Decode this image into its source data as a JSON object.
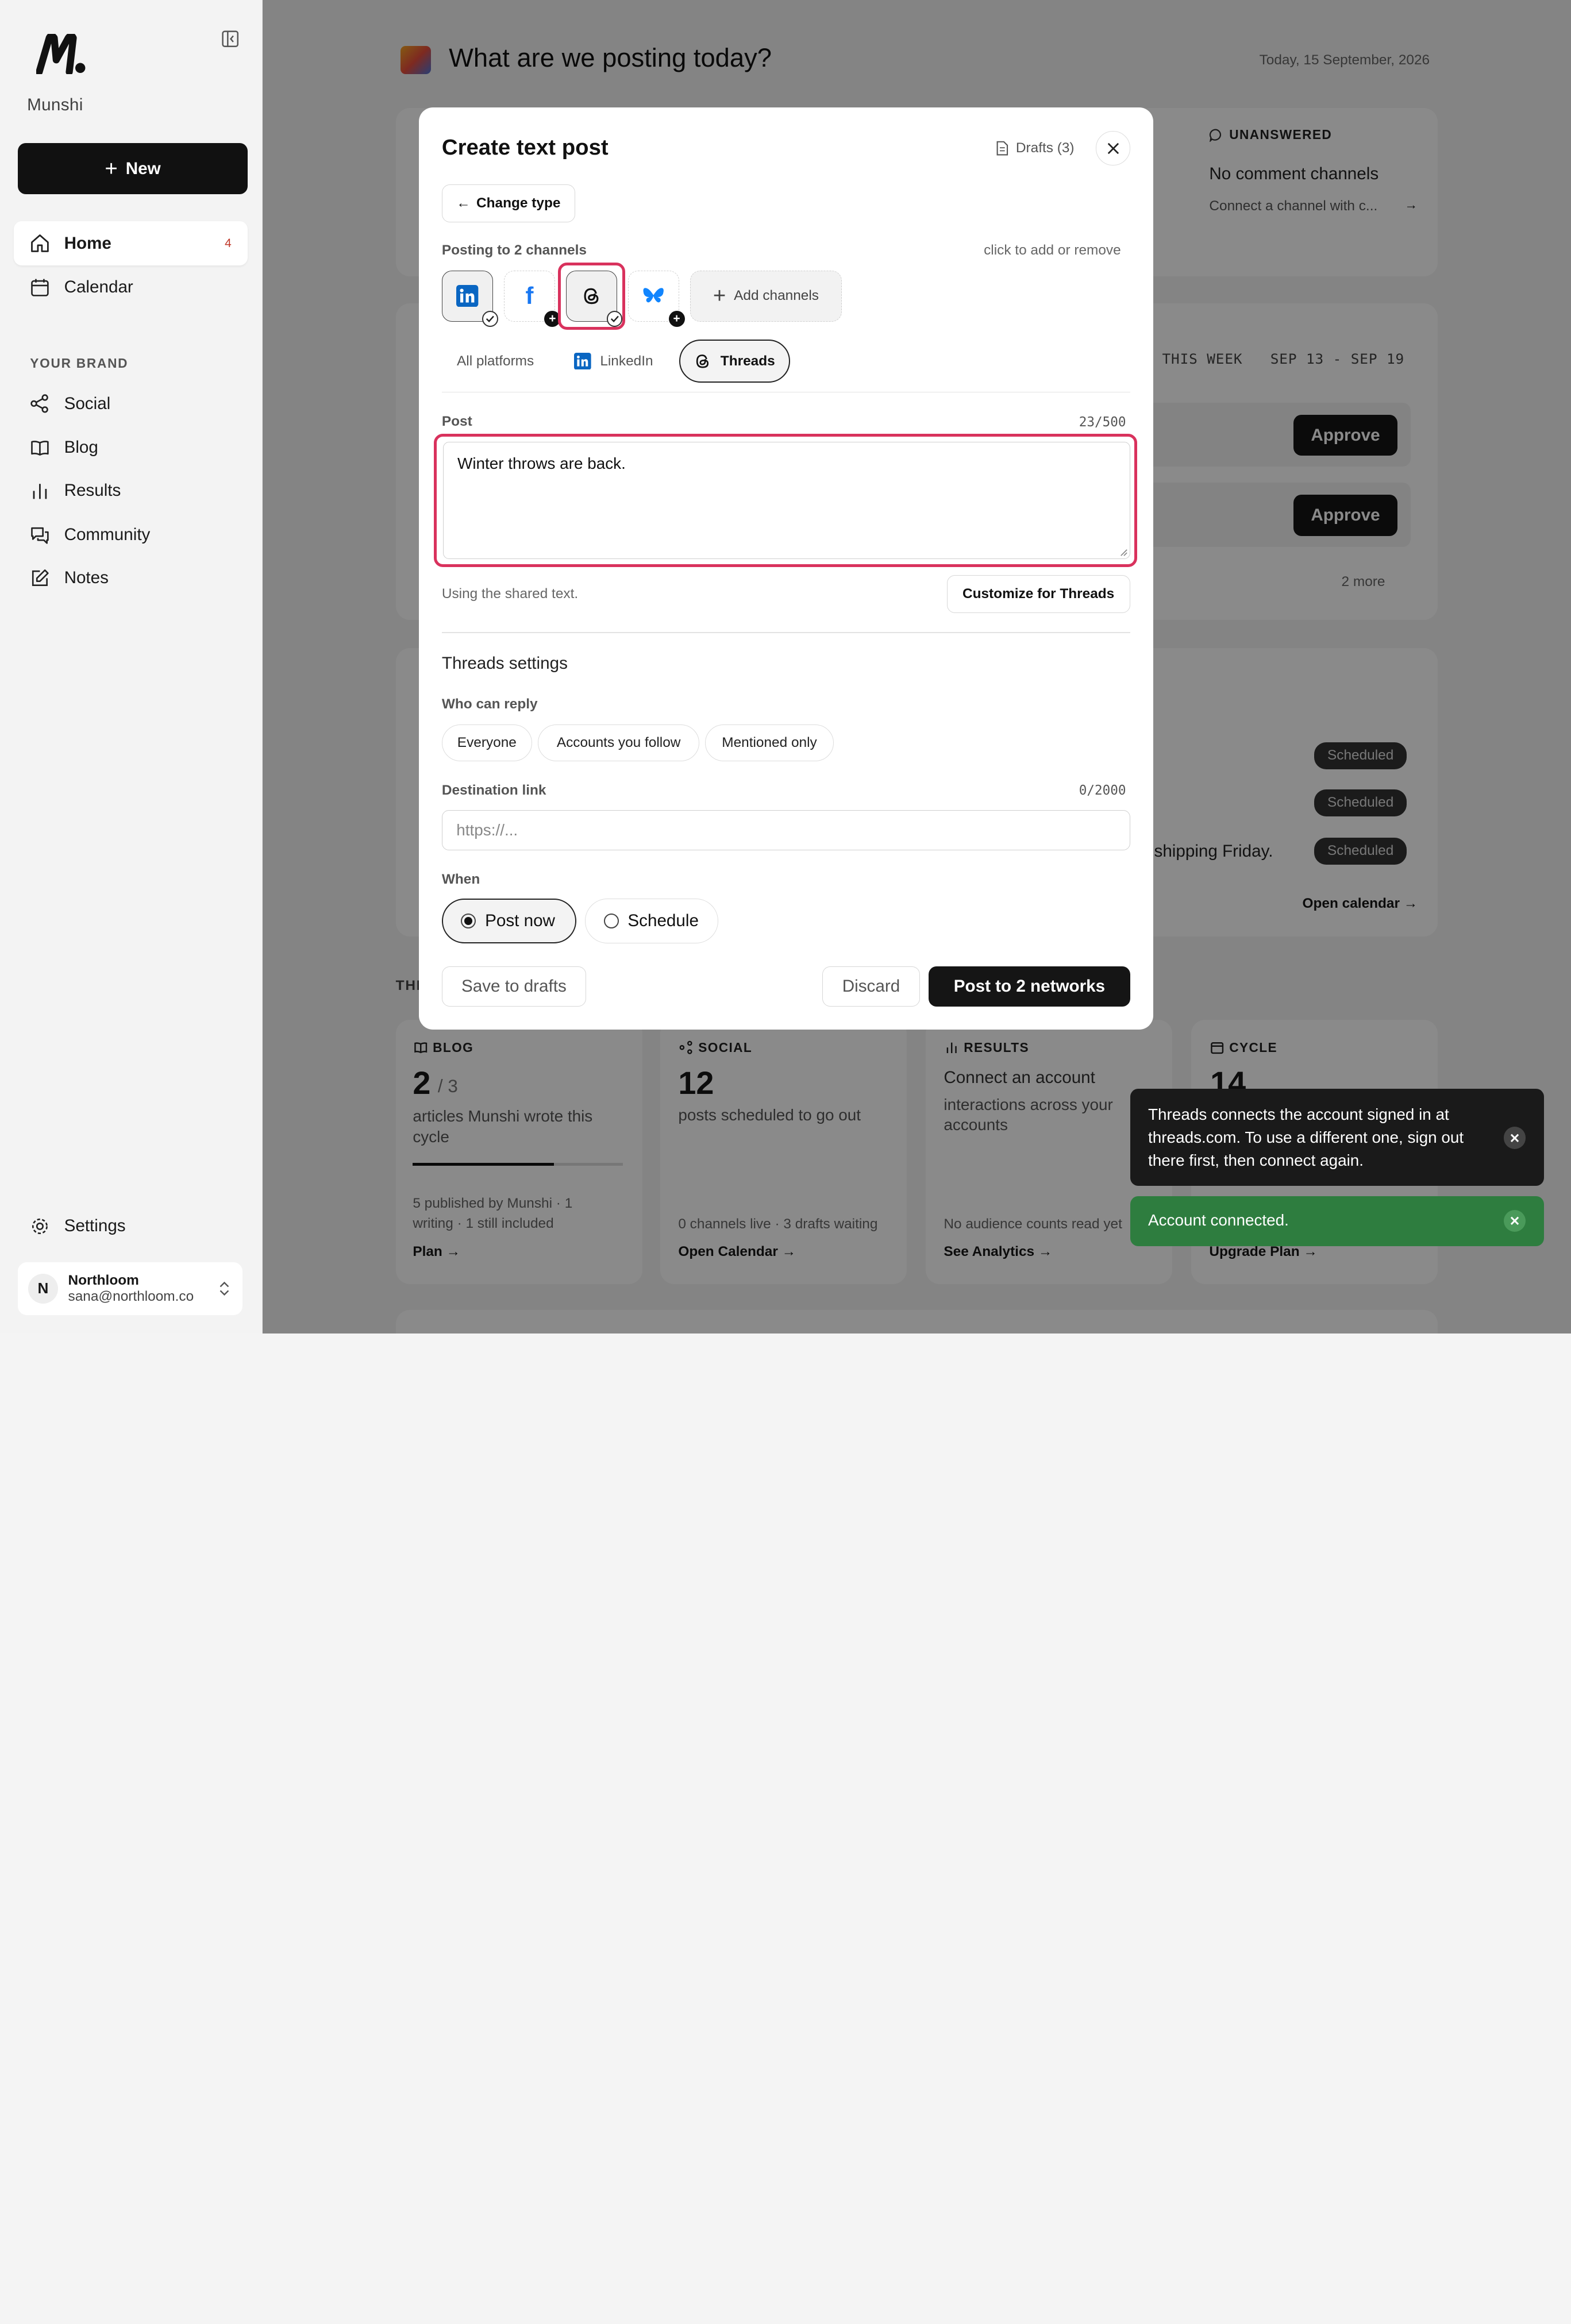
{
  "app": {
    "name": "Munshi",
    "new_label": "New"
  },
  "sidebar": {
    "items": [
      {
        "label": "Home",
        "badge": "4"
      },
      {
        "label": "Calendar"
      }
    ],
    "section_title": "YOUR BRAND",
    "brand_items": [
      {
        "label": "Social"
      },
      {
        "label": "Blog"
      },
      {
        "label": "Results"
      },
      {
        "label": "Community"
      },
      {
        "label": "Notes"
      }
    ],
    "settings_label": "Settings",
    "account": {
      "initial": "N",
      "name": "Northloom",
      "email": "sana@northloom.co"
    }
  },
  "header": {
    "greeting": "What are we posting today?",
    "date": "Today, 15 September, 2026"
  },
  "background": {
    "unanswered": {
      "title": "UNANSWERED",
      "text": "No comment channels",
      "sub": "Connect a channel with c..."
    },
    "week": {
      "label": "THIS WEEK",
      "range": "SEP 13 - SEP 19",
      "approve": "Approve",
      "more": "2 more"
    },
    "scheduled": {
      "pill": "Scheduled",
      "text": "shipping Friday.",
      "link": "Open calendar →"
    },
    "stats": [
      {
        "title": "BLOG",
        "value": "2",
        "of": "/ 3",
        "desc": "articles Munshi wrote this cycle",
        "foot": "5 published by Munshi · 1 writing · 1 still included",
        "link": "Plan →",
        "progress": 0.67
      },
      {
        "title": "SOCIAL",
        "value": "12",
        "desc": "posts scheduled to go out",
        "foot": "0 channels live · 3 drafts waiting",
        "link": "Open Calendar →"
      },
      {
        "title": "RESULTS",
        "desc_title": "Connect an account",
        "desc": "interactions across your accounts",
        "foot": "No audience counts read yet",
        "link": "See Analytics →"
      },
      {
        "title": "CYCLE",
        "value": "14",
        "link": "Upgrade Plan →"
      }
    ],
    "this_label": "THI"
  },
  "modal": {
    "title": "Create text post",
    "drafts": "Drafts (3)",
    "change_type": "Change type",
    "posting_to": "Posting to 2 channels",
    "click_hint": "click to add or remove",
    "channels": [
      {
        "name": "LinkedIn",
        "selected": true
      },
      {
        "name": "Facebook",
        "selected": false
      },
      {
        "name": "Threads",
        "selected": true
      },
      {
        "name": "Bluesky",
        "selected": false
      }
    ],
    "add_channels": "Add channels",
    "tabs": [
      "All platforms",
      "LinkedIn",
      "Threads"
    ],
    "post_label": "Post",
    "post_count": "23/500",
    "post_text": "Winter throws are back.",
    "shared_hint": "Using the shared text.",
    "customize": "Customize for Threads",
    "settings_title": "Threads settings",
    "reply_label": "Who can reply",
    "reply_options": [
      "Everyone",
      "Accounts you follow",
      "Mentioned only"
    ],
    "dest_label": "Destination link",
    "dest_count": "0/2000",
    "dest_placeholder": "https://...",
    "when_label": "When",
    "when_options": [
      "Post now",
      "Schedule"
    ],
    "save_drafts": "Save to drafts",
    "discard": "Discard",
    "post_button": "Post to 2 networks"
  },
  "toasts": {
    "info": "Threads connects the account signed in at threads.com. To use a different one, sign out there first, then connect again.",
    "success": "Account connected."
  },
  "colors": {
    "accent": "#111111",
    "highlight": "#d9325d",
    "success": "#2e7d3f",
    "badge": "#c0392b"
  }
}
